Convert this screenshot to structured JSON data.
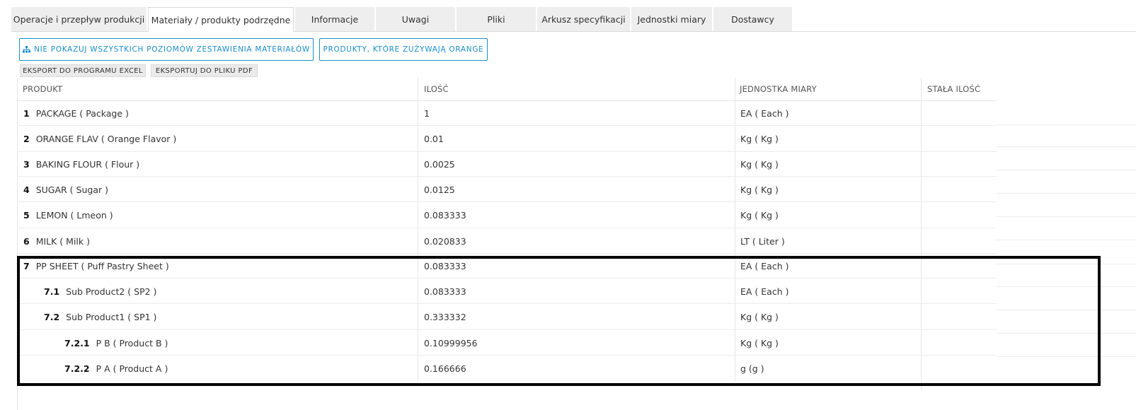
{
  "tabs": [
    {
      "label": "Operacje i przepływ produkcji"
    },
    {
      "label": "Materiały / produkty podrzędne"
    },
    {
      "label": "Informacje"
    },
    {
      "label": "Uwagi"
    },
    {
      "label": "Pliki"
    },
    {
      "label": "Arkusz specyfikacji"
    },
    {
      "label": "Jednostki miary"
    },
    {
      "label": "Dostawcy"
    }
  ],
  "active_tab": "Materiały / produkty podrzędne",
  "toolbar": {
    "levels_button": "NIE POKAZUJ WSZYSTKICH POZIOMÓW ZESTAWIENIA MATERIAŁÓW",
    "consumers_button": "PRODUKTY, KTÓRE ZUŻYWAJĄ ORANGE",
    "export_excel": "EKSPORT DO PROGRAMU EXCEL",
    "export_pdf": "EKSPORTUJ DO PLIKU PDF"
  },
  "table": {
    "headers": {
      "product": "PRODUKT",
      "quantity": "ILOŚĆ",
      "unit": "JEDNOSTKA MIARY",
      "fixed_quantity": "STAŁA ILOŚĆ"
    },
    "rows": [
      {
        "num": "1",
        "product": "PACKAGE ( Package )",
        "quantity": "1",
        "unit": "EA ( Each )",
        "fixed": "",
        "level": 0
      },
      {
        "num": "2",
        "product": "ORANGE FLAV ( Orange Flavor )",
        "quantity": "0.01",
        "unit": "Kg ( Kg )",
        "fixed": "",
        "level": 0
      },
      {
        "num": "3",
        "product": "BAKING FLOUR ( Flour )",
        "quantity": "0.0025",
        "unit": "Kg ( Kg )",
        "fixed": "",
        "level": 0
      },
      {
        "num": "4",
        "product": "SUGAR ( Sugar )",
        "quantity": "0.0125",
        "unit": "Kg ( Kg )",
        "fixed": "",
        "level": 0
      },
      {
        "num": "5",
        "product": "LEMON ( Lmeon )",
        "quantity": "0.083333",
        "unit": "Kg ( Kg )",
        "fixed": "",
        "level": 0
      },
      {
        "num": "6",
        "product": "MILK ( Milk )",
        "quantity": "0.020833",
        "unit": "LT ( Liter )",
        "fixed": "",
        "level": 0
      },
      {
        "num": "7",
        "product": "PP SHEET ( Puff Pastry Sheet )",
        "quantity": "0.083333",
        "unit": "EA ( Each )",
        "fixed": "",
        "level": 0
      },
      {
        "num": "7.1",
        "product": "Sub Product2 ( SP2 )",
        "quantity": "0.083333",
        "unit": "EA ( Each )",
        "fixed": "",
        "level": 1
      },
      {
        "num": "7.2",
        "product": "Sub Product1 ( SP1 )",
        "quantity": "0.333332",
        "unit": "Kg ( Kg )",
        "fixed": "",
        "level": 1
      },
      {
        "num": "7.2.1",
        "product": "P B ( Product B )",
        "quantity": "0.10999956",
        "unit": "Kg ( Kg )",
        "fixed": "",
        "level": 2
      },
      {
        "num": "7.2.2",
        "product": "P A ( Product A )",
        "quantity": "0.166666",
        "unit": "g (g )",
        "fixed": "",
        "level": 2
      }
    ]
  },
  "colors": {
    "accent": "#1a8fc9",
    "tab_bg": "#eeeeee",
    "highlight_border": "#000000"
  }
}
